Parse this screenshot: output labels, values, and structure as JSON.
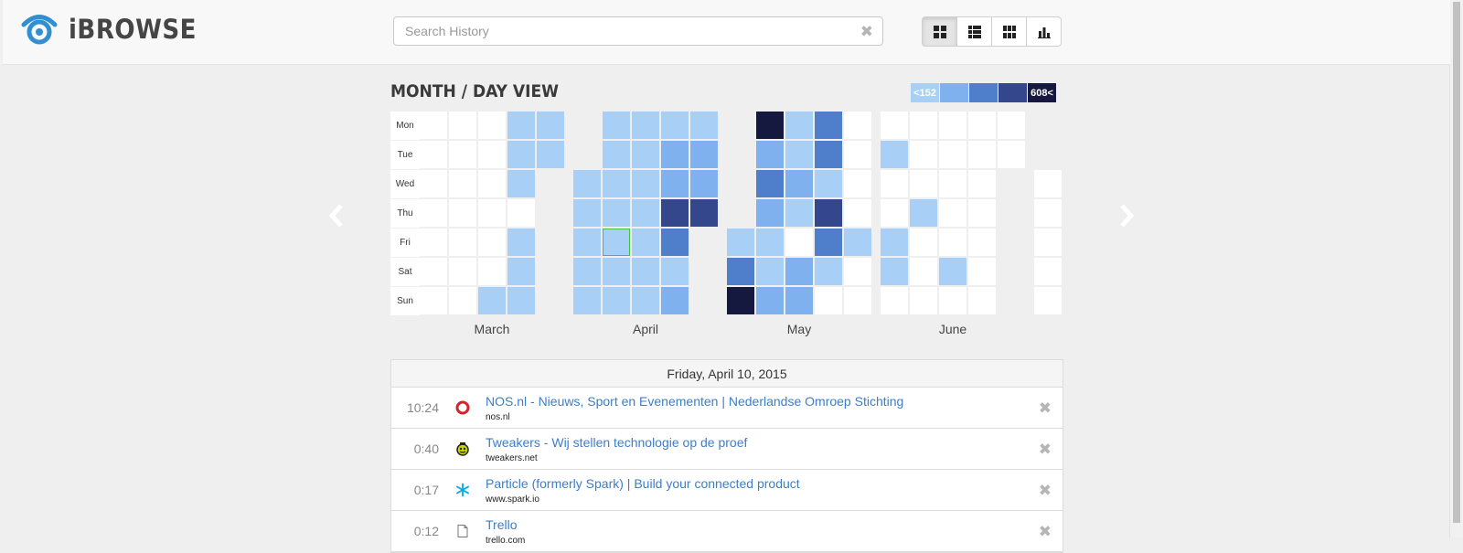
{
  "app": {
    "name": "iBROWSE"
  },
  "search": {
    "placeholder": "Search History",
    "value": ""
  },
  "view_buttons": [
    {
      "name": "grid-view-button",
      "icon": "grid-icon",
      "active": true
    },
    {
      "name": "list-view-button",
      "icon": "list-icon",
      "active": false
    },
    {
      "name": "columns-view-button",
      "icon": "columns-icon",
      "active": false
    },
    {
      "name": "chart-view-button",
      "icon": "bar-chart-icon",
      "active": false
    }
  ],
  "calendar": {
    "title": "MONTH / DAY VIEW",
    "legend": [
      {
        "label": "<152",
        "color": "#a8d0f6"
      },
      {
        "label": "",
        "color": "#7fb1ee"
      },
      {
        "label": "",
        "color": "#4f7fcb"
      },
      {
        "label": "",
        "color": "#34468c"
      },
      {
        "label": "608<",
        "color": "#16193f"
      }
    ],
    "days": [
      "Mon",
      "Tue",
      "Wed",
      "Thu",
      "Fri",
      "Sat",
      "Sun"
    ],
    "months": [
      {
        "name": "March",
        "weeks": [
          [
            0,
            0,
            0,
            0,
            0,
            0,
            0
          ],
          [
            0,
            0,
            0,
            0,
            0,
            0,
            0
          ],
          [
            0,
            0,
            0,
            0,
            0,
            0,
            1
          ],
          [
            1,
            1,
            1,
            0,
            1,
            1,
            1
          ],
          [
            1,
            1,
            null,
            null,
            null,
            null,
            null
          ]
        ]
      },
      {
        "name": "April",
        "weeks": [
          [
            null,
            null,
            1,
            1,
            1,
            1,
            1
          ],
          [
            1,
            1,
            1,
            1,
            1,
            1,
            1
          ],
          [
            1,
            1,
            1,
            1,
            1,
            1,
            1
          ],
          [
            1,
            2,
            2,
            4,
            3,
            1,
            2
          ],
          [
            1,
            2,
            2,
            4,
            null,
            null,
            null
          ]
        ]
      },
      {
        "name": "May",
        "weeks": [
          [
            null,
            null,
            null,
            null,
            1,
            3,
            5
          ],
          [
            5,
            2,
            3,
            2,
            1,
            1,
            2
          ],
          [
            1,
            1,
            2,
            1,
            0,
            2,
            2
          ],
          [
            3,
            3,
            1,
            4,
            3,
            1,
            0
          ],
          [
            0,
            0,
            0,
            0,
            1,
            0,
            0
          ]
        ]
      },
      {
        "name": "June",
        "weeks": [
          [
            0,
            1,
            0,
            0,
            1,
            1,
            0
          ],
          [
            0,
            0,
            0,
            1,
            0,
            0,
            0
          ],
          [
            0,
            0,
            0,
            0,
            0,
            1,
            0
          ],
          [
            0,
            0,
            0,
            0,
            0,
            0,
            0
          ],
          [
            0,
            0,
            null,
            null,
            null,
            null,
            null
          ]
        ]
      },
      {
        "name": "",
        "weeks": [
          [
            null,
            null,
            0,
            0,
            0,
            0,
            0
          ]
        ]
      }
    ],
    "selected": {
      "month": 1,
      "week": 1,
      "day": 4
    }
  },
  "history": {
    "date": "Friday, April 10, 2015",
    "entries": [
      {
        "time": "10:24",
        "icon": "nos-logo-icon",
        "title": "NOS.nl - Nieuws, Sport en Evenementen | Nederlandse Omroep Stichting",
        "domain": "nos.nl"
      },
      {
        "time": "0:40",
        "icon": "tweakers-logo-icon",
        "title": "Tweakers - Wij stellen technologie op de proef",
        "domain": "tweakers.net"
      },
      {
        "time": "0:17",
        "icon": "spark-logo-icon",
        "title": "Particle (formerly Spark) | Build your connected product",
        "domain": "www.spark.io"
      },
      {
        "time": "0:12",
        "icon": "document-icon",
        "title": "Trello",
        "domain": "trello.com"
      }
    ]
  }
}
